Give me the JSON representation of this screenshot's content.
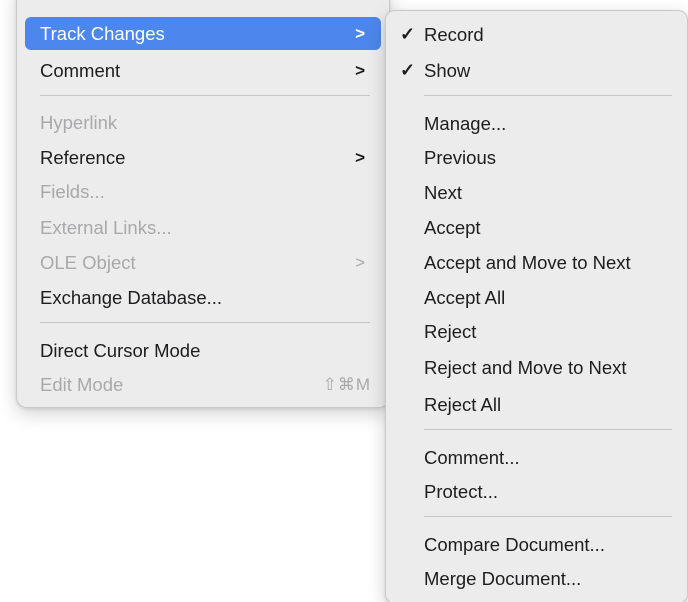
{
  "main_menu": {
    "items": [
      {
        "label": "Track Changes",
        "submenu": true,
        "state": "highlighted"
      },
      {
        "label": "Comment",
        "submenu": true,
        "state": "enabled"
      },
      {
        "label": "Hyperlink",
        "submenu": false,
        "state": "disabled"
      },
      {
        "label": "Reference",
        "submenu": true,
        "state": "enabled"
      },
      {
        "label": "Fields...",
        "submenu": false,
        "state": "disabled"
      },
      {
        "label": "External Links...",
        "submenu": false,
        "state": "disabled"
      },
      {
        "label": "OLE Object",
        "submenu": true,
        "state": "disabled"
      },
      {
        "label": "Exchange Database...",
        "submenu": false,
        "state": "enabled"
      },
      {
        "label": "Direct Cursor Mode",
        "submenu": false,
        "state": "enabled"
      },
      {
        "label": "Edit Mode",
        "submenu": false,
        "state": "disabled",
        "shortcut": "⇧⌘M"
      }
    ],
    "arrow_glyph": ">"
  },
  "submenu": {
    "title_of_parent": "Track Changes",
    "check_glyph": "✓",
    "items": [
      {
        "label": "Record",
        "checked": true
      },
      {
        "label": "Show",
        "checked": true
      },
      {
        "label": "Manage..."
      },
      {
        "label": "Previous"
      },
      {
        "label": "Next"
      },
      {
        "label": "Accept"
      },
      {
        "label": "Accept and Move to Next"
      },
      {
        "label": "Accept All"
      },
      {
        "label": "Reject"
      },
      {
        "label": "Reject and Move to Next"
      },
      {
        "label": "Reject All"
      },
      {
        "label": "Comment..."
      },
      {
        "label": "Protect..."
      },
      {
        "label": "Compare Document..."
      },
      {
        "label": "Merge Document..."
      }
    ]
  },
  "colors": {
    "menu_background": "#ececec",
    "highlight": "#4d86ec",
    "text": "#1d1d1f",
    "disabled_text": "#a9a9ab",
    "separator": "#c6c6c8"
  }
}
